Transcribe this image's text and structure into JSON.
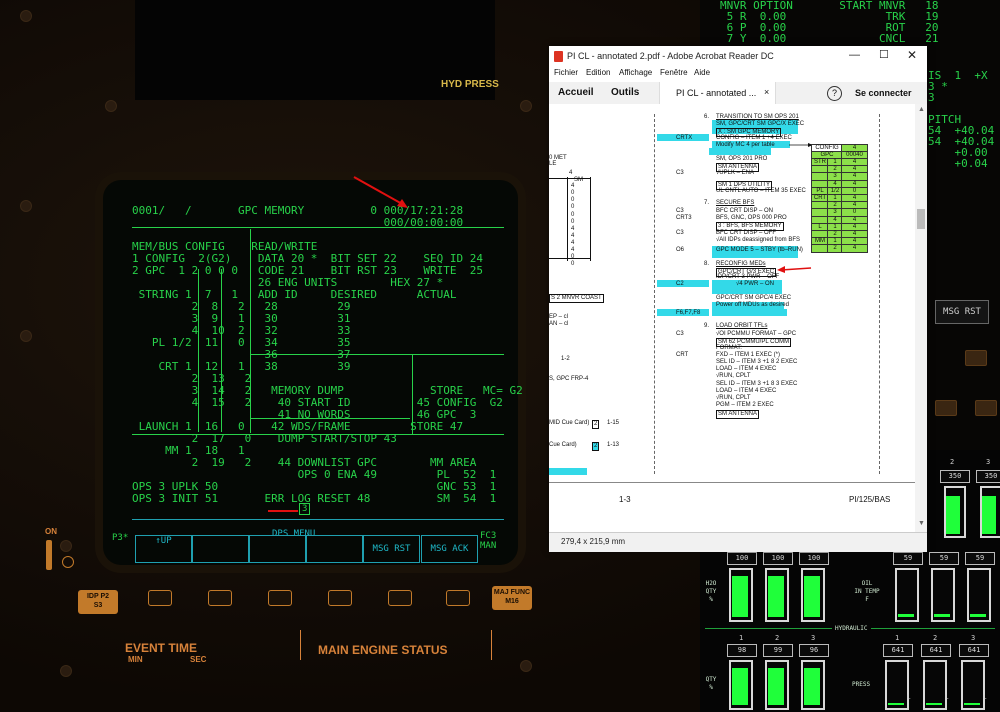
{
  "cockpit": {
    "hyd_press_label": "HYD PRESS",
    "on_label": "ON",
    "event_time_label": "EVENT TIME",
    "event_time_min": "MIN",
    "event_time_sec": "SEC",
    "main_engine_status": "MAIN ENGINE STATUS",
    "idp_pill": "IDP P2\nS3",
    "major_func_pill": "MAJ FUNC\nM16",
    "p3_label": "P3*",
    "fc3_label": "FC3",
    "man_label": "MAN",
    "dps_menu_label": "DPS MENU",
    "up_label": "UP",
    "msg_rst_label": "MSG RST",
    "msg_ack_label": "MSG ACK",
    "page_indicator": "3"
  },
  "dps": {
    "lines": [
      "0001/   /       GPC MEMORY          0 000/17:21:28",
      "                                      000/00:00:00",
      "",
      "MEM/BUS CONFIG    READ/WRITE",
      "1 CONFIG  2(G2)    DATA 20 *  BIT SET 22    SEQ ID 24",
      "2 GPC  1 2 0 0 0   CODE 21    BIT RST 23    WRITE  25",
      "                   26 ENG UNITS        HEX 27 *",
      " STRING 1  7   1   ADD ID     DESIRED      ACTUAL",
      "         2  8   2   28         29",
      "         3  9   1   30         31",
      "         4  10  2   32         33",
      "   PL 1/2  11   0   34         35",
      "                    36         37",
      "    CRT 1  12   1   38         39",
      "         2  13   2",
      "         3  14   2   MEMORY DUMP             STORE   MC= G2",
      "         4  15   2    40 START ID          45 CONFIG  G2",
      "                      41 NO WORDS          46 GPC  3",
      " LAUNCH 1  16   0    42 WDS/FRAME         STORE 47",
      "         2  17   0    DUMP START/STOP 43",
      "     MM 1  18   1",
      "         2  19   2    44 DOWNLIST GPC        MM AREA",
      "                         OPS 0 ENA 49         PL  52  1",
      "OPS 3 UPLK 50                                 GNC 53  1",
      "OPS 3 INIT 51       ERR LOG RESET 48          SM  54  1"
    ]
  },
  "right_crt": {
    "lines": [
      "MNVR OPTION       START MNVR   18",
      " 5 R  0.00               TRK   19",
      " 6 P  0.00               ROT   20",
      " 7 Y  0.00              CNCL   21"
    ],
    "side_lines": [
      "IS  1  +X",
      "3 *",
      "3",
      "",
      "PITCH",
      "54  +40.04",
      "54  +40.04",
      "    +0.00",
      "    +0.04"
    ],
    "msg_rst": "MSG RST"
  },
  "gauges": {
    "hydraulic_label": "HYDRAULIC",
    "h2o_qty_label": "H2O\nQTY\n%",
    "oil_in_temp_label": "OIL\nIN TEMP\nF",
    "qty_label": "QTY\n%",
    "press_label": "PRESS",
    "top_nums": [
      "2",
      "3"
    ],
    "top_vals": [
      "350",
      "350"
    ],
    "h2o_vals": [
      "100",
      "100",
      "100"
    ],
    "h2o_fill": [
      0.85,
      0.85,
      0.85
    ],
    "oil_vals": [
      "59",
      "59",
      "59"
    ],
    "oil_fill": [
      0.06,
      0.06,
      0.06
    ],
    "hyd_nums": [
      "1",
      "2",
      "3"
    ],
    "hyd_qty_vals": [
      "98",
      "99",
      "96"
    ],
    "hyd_qty_fill": [
      0.85,
      0.85,
      0.85
    ],
    "press_vals": [
      "641",
      "641",
      "641"
    ],
    "press_fill": [
      0.05,
      0.05,
      0.05
    ],
    "letter_l": "L"
  },
  "acrobat": {
    "title": "PI CL - annotated 2.pdf - Adobe Acrobat Reader DC",
    "menu": [
      "Fichier",
      "Edition",
      "Affichage",
      "Fenêtre",
      "Aide"
    ],
    "tab_home": "Accueil",
    "tab_tools": "Outils",
    "tab_doc": "PI CL - annotated ...",
    "tab_close": "×",
    "help": "?",
    "connect": "Se connecter",
    "status_size": "279,4 x 215,9 mm",
    "page_num_left": "1-3",
    "page_ref_right": "PI/125/BAS"
  },
  "pdf": {
    "left_frag": [
      "0 MET",
      "LE",
      "4",
      "SM",
      "4",
      "0",
      "0",
      "0",
      "0",
      "0",
      "4",
      "4",
      "4",
      "4",
      "0",
      "0",
      "S 2 MNVR COAST",
      "EP – cl",
      "AN – cl",
      "1-2",
      "S, GPC FRP-4",
      "MID Cue Card)",
      "Cue Card)"
    ],
    "left_frag_box1": "2",
    "left_frag_box2": "2",
    "left_frag_tail1": "1-15",
    "left_frag_tail2": "1-13",
    "item6_num": "6.",
    "item6_title": "TRANSITION TO SM OPS 201",
    "item6_l1": "SM, GPC/CRT SM GPC/X EXEC",
    "item6_l2": "X : SM GPC MEMORY",
    "item6_l3": "CONFIG – ITEM 1 +4 EXEC",
    "item6_l4": "Modify MC 4 per table",
    "crtx": "CRTX",
    "l_sm_ops": "SM, OPS 201 PRO",
    "l_sm_antenna": "SM ANTENNA",
    "c3_a": "C3",
    "l_uplk": "√UPLK – ENA",
    "l_sm1": "SM 1 DPS UTILITY",
    "l_ul": "UL CNTL AUTO – ITEM 35 EXEC",
    "item7_num": "7.",
    "item7_title": "SECURE BFS",
    "c3_b": "C3",
    "crt3": "CRT3",
    "l_bfc1": "BFC CRT DISP – ON",
    "l_bfs_gnc": "BFS, GNC, OPS 000 PRO",
    "l_bfs_mem": "3 : BFS, BFS MEMORY",
    "c3_c": "C3",
    "l_bfc2": "BFC CRT DISP – OFF",
    "l_idp": "√All IDPs deassigned from BFS",
    "o6": "O6",
    "l_gpc5": "GPC MODE 5 – STBY (tb–RUN)",
    "item8_num": "8.",
    "item8_title": "RECONFIG MEDs",
    "l_gpccrt": "GPC/CRT G/3 EXEC",
    "c2": "C2",
    "l_idpcrt": "IDP/CRT 3 PWR – OFF",
    "l_v4": "√4 PWR – ON",
    "l_gpcsm": "GPC/CRT SM GPC/4 EXEC",
    "f6": "F6,F7,F8",
    "l_power": "Power off MDUs as desired",
    "item9_num": "9.",
    "item9_title": "LOAD ORBIT TFLs",
    "c3_d": "C3",
    "l_pcmmu": "√OI PCMMU FORMAT – GPC",
    "l_sm62": "SM 62 PCMMU/PL COMM",
    "crt": "CRT",
    "l_format": "FORMAT:",
    "l_fxd": "FXD     –  ITEM 1 EXEC (*)",
    "l_selid1": "SEL ID  –  ITEM 3 +1 8 2 EXEC",
    "l_load1": "LOAD    –  ITEM 4 EXEC",
    "l_run1": "             √RUN, CPLT",
    "l_selid2": "SEL ID  –  ITEM 3 +1 8 3 EXEC",
    "l_load2": "LOAD    –  ITEM 4 EXEC",
    "l_run2": "             √RUN, CPLT",
    "l_pgm": "PGM     –  ITEM 2 EXEC",
    "l_sm_ant2": "SM ANTENNA",
    "table_header_config": "CONFIG",
    "table_header_mc": "4",
    "table_header_gpc": "GPC",
    "table_header_gpcval": "00040",
    "table_rows": [
      {
        "label": "STR",
        "n": "1",
        "v": "4"
      },
      {
        "label": "",
        "n": "2",
        "v": "4"
      },
      {
        "label": "",
        "n": "3",
        "v": "4"
      },
      {
        "label": "",
        "n": "4",
        "v": "4"
      },
      {
        "label": "PL",
        "n": "1/2",
        "v": "0"
      },
      {
        "label": "CRT",
        "n": "1",
        "v": "4"
      },
      {
        "label": "",
        "n": "2",
        "v": "4"
      },
      {
        "label": "",
        "n": "3",
        "v": "0"
      },
      {
        "label": "",
        "n": "4",
        "v": "4"
      },
      {
        "label": "L",
        "n": "1",
        "v": "4"
      },
      {
        "label": "",
        "n": "2",
        "v": "4"
      },
      {
        "label": "MM",
        "n": "1",
        "v": "4"
      },
      {
        "label": "",
        "n": "2",
        "v": "4"
      }
    ]
  }
}
